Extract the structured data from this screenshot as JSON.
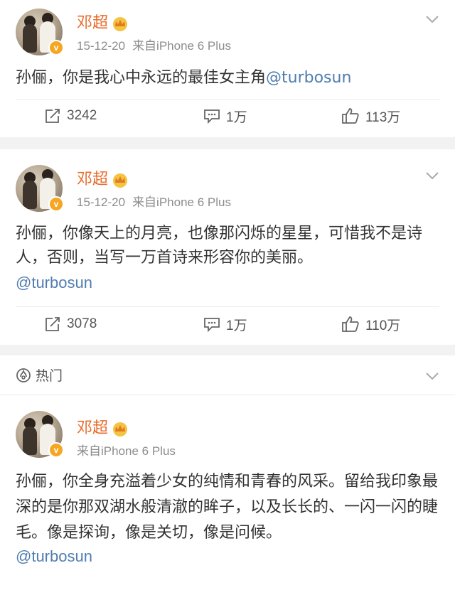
{
  "posts": [
    {
      "author": "邓超",
      "date": "15-12-20",
      "source": "来自iPhone 6 Plus",
      "text": "孙俪，你是我心中永远的最佳女主角",
      "mention": "@turbosun",
      "reposts": "3242",
      "comments": "1万",
      "likes": "113万"
    },
    {
      "author": "邓超",
      "date": "15-12-20",
      "source": "来自iPhone 6 Plus",
      "text": "孙俪，你像天上的月亮，也像那闪烁的星星，可惜我不是诗人，否则，当写一万首诗来形容你的美丽。",
      "mention": "@turbosun",
      "reposts": "3078",
      "comments": "1万",
      "likes": "110万"
    },
    {
      "section_label": "热门",
      "author": "邓超",
      "source": "来自iPhone 6 Plus",
      "text": "孙俪，你全身充溢着少女的纯情和青春的风采。留给我印象最深的是你那双湖水般清澈的眸子，以及长长的、一闪一闪的睫毛。像是探询，像是关切，像是问候。",
      "mention": "@turbosun"
    }
  ],
  "colors": {
    "username": "#e86b2b",
    "mention": "#507daf",
    "meta": "#8c8c8c",
    "background": "#f2f2f2",
    "badge": "#f5a623"
  },
  "icons": [
    "avatar",
    "verified-badge",
    "crown-icon",
    "chevron-down-icon",
    "repost-icon",
    "comment-icon",
    "like-icon",
    "hot-icon"
  ]
}
